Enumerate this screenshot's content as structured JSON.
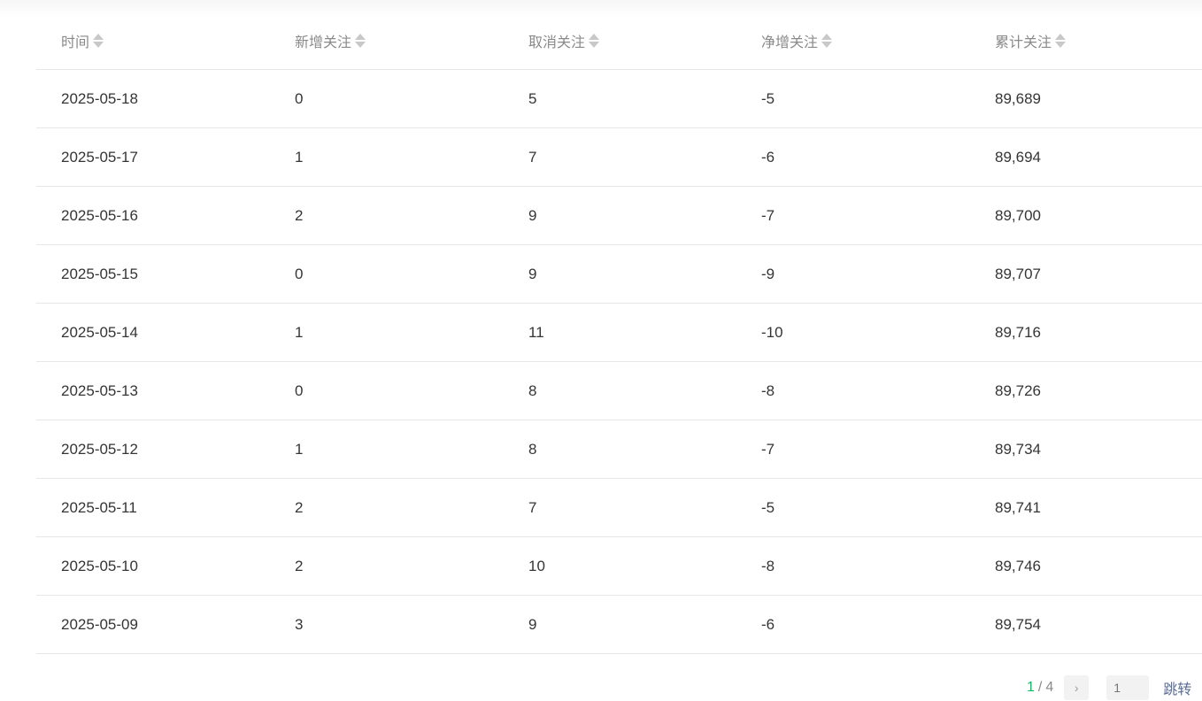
{
  "table": {
    "headers": [
      "时间",
      "新增关注",
      "取消关注",
      "净增关注",
      "累计关注"
    ],
    "rows": [
      [
        "2025-05-18",
        "0",
        "5",
        "-5",
        "89,689"
      ],
      [
        "2025-05-17",
        "1",
        "7",
        "-6",
        "89,694"
      ],
      [
        "2025-05-16",
        "2",
        "9",
        "-7",
        "89,700"
      ],
      [
        "2025-05-15",
        "0",
        "9",
        "-9",
        "89,707"
      ],
      [
        "2025-05-14",
        "1",
        "11",
        "-10",
        "89,716"
      ],
      [
        "2025-05-13",
        "0",
        "8",
        "-8",
        "89,726"
      ],
      [
        "2025-05-12",
        "1",
        "8",
        "-7",
        "89,734"
      ],
      [
        "2025-05-11",
        "2",
        "7",
        "-5",
        "89,741"
      ],
      [
        "2025-05-10",
        "2",
        "10",
        "-8",
        "89,746"
      ],
      [
        "2025-05-09",
        "3",
        "9",
        "-6",
        "89,754"
      ]
    ]
  },
  "pagination": {
    "current": "1",
    "separator": "/",
    "total": "4",
    "next_icon": "chevron-right-icon",
    "next_glyph": "›",
    "jump_placeholder": "1",
    "jump_label": "跳转"
  },
  "colors": {
    "accent": "#07c160",
    "header_text": "#8a8a8a",
    "cell_text": "#353535",
    "divider": "#e7e7e7"
  }
}
